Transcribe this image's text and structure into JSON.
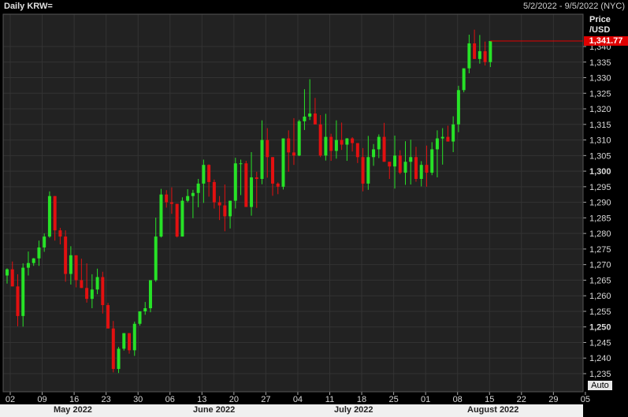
{
  "header": {
    "title": "Daily KRW=",
    "range": "5/2/2022 - 9/5/2022 (NYC)"
  },
  "axis": {
    "price_label_1": "Price",
    "price_label_2": "/USD",
    "last_value": "1,341.77",
    "auto_label": "Auto"
  },
  "colors": {
    "up": "#27e227",
    "down": "#e21010",
    "background": "#222222",
    "grid": "#333333"
  },
  "chart_data": {
    "type": "candlestick",
    "title": "Daily KRW=",
    "ylabel": "Price /USD",
    "ylim": [
      1232,
      1347
    ],
    "yticks": [
      "1,235",
      "1,240",
      "1,245",
      "1,250",
      "1,255",
      "1,260",
      "1,265",
      "1,270",
      "1,275",
      "1,280",
      "1,285",
      "1,290",
      "1,295",
      "1,300",
      "1,305",
      "1,310",
      "1,315",
      "1,320",
      "1,325",
      "1,330",
      "1,335",
      "1,340"
    ],
    "bold_ticks": [
      "1,250",
      "1,300"
    ],
    "xticks": [
      "02",
      "09",
      "16",
      "23",
      "30",
      "06",
      "13",
      "20",
      "27",
      "04",
      "11",
      "18",
      "25",
      "01",
      "08",
      "15",
      "22",
      "29",
      "05"
    ],
    "months": [
      "May 2022",
      "June 2022",
      "July 2022",
      "August 2022"
    ],
    "last_price": 1341.77,
    "grid": true,
    "candles": [
      [
        1266.5,
        1268.8,
        1263.9,
        1268.5
      ],
      [
        1268.5,
        1271.0,
        1266.9,
        1263.0
      ],
      [
        1263.0,
        1266.9,
        1250.2,
        1253.5
      ],
      [
        1253.5,
        1270.4,
        1250.1,
        1269.0
      ],
      [
        1269.0,
        1274.2,
        1266.5,
        1270.5
      ],
      [
        1270.5,
        1272.1,
        1269.6,
        1272.0
      ],
      [
        1272.0,
        1277.7,
        1269.6,
        1275.5
      ],
      [
        1275.5,
        1280.0,
        1274.1,
        1279.0
      ],
      [
        1279.0,
        1293.5,
        1278.6,
        1292.0
      ],
      [
        1292.0,
        1291.7,
        1277.7,
        1281.0
      ],
      [
        1281.0,
        1281.8,
        1276.5,
        1279.0
      ],
      [
        1279.0,
        1281.0,
        1264.5,
        1267.0
      ],
      [
        1267.0,
        1275.9,
        1263.6,
        1273.0
      ],
      [
        1273.0,
        1271.3,
        1262.7,
        1265.0
      ],
      [
        1265.0,
        1271.9,
        1262.9,
        1262.5
      ],
      [
        1262.5,
        1270.4,
        1257.8,
        1259.0
      ],
      [
        1259.0,
        1266.9,
        1256.0,
        1262.0
      ],
      [
        1262.0,
        1268.7,
        1260.5,
        1266.0
      ],
      [
        1266.0,
        1267.7,
        1254.3,
        1257.0
      ],
      [
        1257.0,
        1257.7,
        1249.8,
        1249.5
      ],
      [
        1249.5,
        1251.9,
        1235.4,
        1236.5
      ],
      [
        1236.5,
        1243.6,
        1235.2,
        1243.0
      ],
      [
        1243.0,
        1244.7,
        1242.4,
        1248.0
      ],
      [
        1248.0,
        1248.0,
        1241.4,
        1242.5
      ],
      [
        1242.5,
        1251.7,
        1240.7,
        1251.0
      ],
      [
        1251.0,
        1254.1,
        1250.4,
        1255.0
      ],
      [
        1255.0,
        1258.0,
        1253.9,
        1256.0
      ],
      [
        1256.0,
        1258.2,
        1254.7,
        1265.0
      ],
      [
        1265.0,
        1285.1,
        1264.5,
        1279.0
      ],
      [
        1279.0,
        1294.3,
        1278.7,
        1292.5
      ],
      [
        1292.5,
        1293.9,
        1288.3,
        1290.0
      ],
      [
        1290.0,
        1294.8,
        1286.3,
        1289.5
      ],
      [
        1289.5,
        1281.7,
        1278.7,
        1279.0
      ],
      [
        1279.0,
        1291.6,
        1279.7,
        1290.5
      ],
      [
        1290.5,
        1294.2,
        1290.0,
        1292.0
      ],
      [
        1292.0,
        1294.0,
        1284.9,
        1293.0
      ],
      [
        1293.0,
        1297.5,
        1288.4,
        1296.0
      ],
      [
        1296.0,
        1303.7,
        1289.8,
        1302.0
      ],
      [
        1302.0,
        1302.2,
        1291.8,
        1296.5
      ],
      [
        1296.5,
        1297.3,
        1288.0,
        1290.0
      ],
      [
        1290.0,
        1292.0,
        1284.3,
        1289.0
      ],
      [
        1289.0,
        1295.7,
        1280.7,
        1285.5
      ],
      [
        1285.5,
        1289.9,
        1281.6,
        1290.5
      ],
      [
        1290.5,
        1304.3,
        1288.0,
        1302.5
      ],
      [
        1302.5,
        1303.7,
        1292.3,
        1302.5
      ],
      [
        1302.5,
        1303.3,
        1289.6,
        1288.5
      ],
      [
        1288.5,
        1306.1,
        1285.7,
        1298.0
      ],
      [
        1298.0,
        1299.8,
        1288.2,
        1297.5
      ],
      [
        1297.5,
        1316.3,
        1295.8,
        1310.0
      ],
      [
        1310.0,
        1313.8,
        1297.9,
        1304.5
      ],
      [
        1304.5,
        1303.2,
        1292.1,
        1296.0
      ],
      [
        1296.0,
        1296.4,
        1292.6,
        1295.0
      ],
      [
        1295.0,
        1309.5,
        1294.1,
        1310.5
      ],
      [
        1310.5,
        1313.1,
        1299.8,
        1306.0
      ],
      [
        1306.0,
        1317.0,
        1302.0,
        1305.0
      ],
      [
        1305.0,
        1316.5,
        1304.8,
        1316.0
      ],
      [
        1316.0,
        1326.3,
        1313.2,
        1317.5
      ],
      [
        1317.5,
        1329.5,
        1316.4,
        1318.5
      ],
      [
        1318.5,
        1323.5,
        1317.6,
        1315.0
      ],
      [
        1315.0,
        1318.0,
        1304.5,
        1305.0
      ],
      [
        1305.0,
        1318.4,
        1303.4,
        1311.0
      ],
      [
        1311.0,
        1312.0,
        1303.3,
        1306.5
      ],
      [
        1306.5,
        1316.3,
        1304.0,
        1310.0
      ],
      [
        1310.0,
        1315.6,
        1306.8,
        1308.5
      ],
      [
        1308.5,
        1310.6,
        1303.3,
        1310.5
      ],
      [
        1310.5,
        1310.9,
        1306.3,
        1309.0
      ],
      [
        1309.0,
        1308.9,
        1302.6,
        1304.5
      ],
      [
        1304.5,
        1307.4,
        1293.5,
        1296.0
      ],
      [
        1296.0,
        1311.3,
        1294.0,
        1304.5
      ],
      [
        1304.5,
        1308.7,
        1301.7,
        1307.0
      ],
      [
        1307.0,
        1311.8,
        1304.2,
        1311.0
      ],
      [
        1311.0,
        1315.5,
        1305.4,
        1303.0
      ],
      [
        1303.0,
        1302.4,
        1297.5,
        1301.5
      ],
      [
        1301.5,
        1311.4,
        1294.4,
        1305.0
      ],
      [
        1305.0,
        1306.7,
        1299.0,
        1299.5
      ],
      [
        1299.5,
        1309.6,
        1295.6,
        1303.0
      ],
      [
        1303.0,
        1310.1,
        1295.7,
        1304.5
      ],
      [
        1304.5,
        1307.8,
        1296.6,
        1297.5
      ],
      [
        1297.5,
        1303.2,
        1295.1,
        1302.0
      ],
      [
        1302.0,
        1308.2,
        1295.0,
        1299.5
      ],
      [
        1299.5,
        1309.3,
        1298.7,
        1307.0
      ],
      [
        1307.0,
        1313.1,
        1298.0,
        1310.5
      ],
      [
        1310.5,
        1313.8,
        1302.1,
        1311.0
      ],
      [
        1311.0,
        1314.6,
        1310.7,
        1309.5
      ],
      [
        1309.5,
        1317.6,
        1306.1,
        1315.0
      ],
      [
        1315.0,
        1327.4,
        1312.5,
        1326.0
      ],
      [
        1326.0,
        1331.3,
        1325.3,
        1333.0
      ],
      [
        1333.0,
        1343.8,
        1331.4,
        1341.0
      ],
      [
        1341.0,
        1345.4,
        1336.9,
        1336.0
      ],
      [
        1336.0,
        1343.7,
        1334.5,
        1338.5
      ],
      [
        1338.5,
        1341.6,
        1333.9,
        1335.0
      ],
      [
        1335.0,
        1335.4,
        1333.4,
        1341.77
      ]
    ]
  }
}
